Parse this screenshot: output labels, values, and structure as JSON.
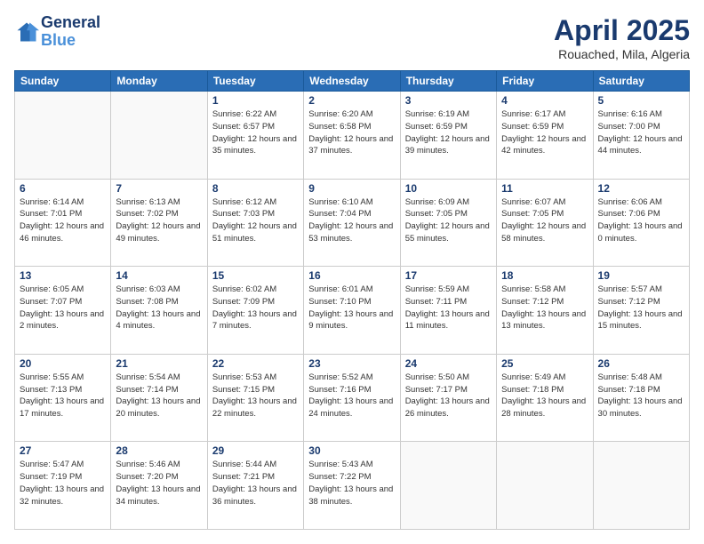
{
  "header": {
    "logo_line1": "General",
    "logo_line2": "Blue",
    "month": "April 2025",
    "location": "Rouached, Mila, Algeria"
  },
  "weekdays": [
    "Sunday",
    "Monday",
    "Tuesday",
    "Wednesday",
    "Thursday",
    "Friday",
    "Saturday"
  ],
  "weeks": [
    [
      {
        "day": "",
        "info": ""
      },
      {
        "day": "",
        "info": ""
      },
      {
        "day": "1",
        "info": "Sunrise: 6:22 AM\nSunset: 6:57 PM\nDaylight: 12 hours and 35 minutes."
      },
      {
        "day": "2",
        "info": "Sunrise: 6:20 AM\nSunset: 6:58 PM\nDaylight: 12 hours and 37 minutes."
      },
      {
        "day": "3",
        "info": "Sunrise: 6:19 AM\nSunset: 6:59 PM\nDaylight: 12 hours and 39 minutes."
      },
      {
        "day": "4",
        "info": "Sunrise: 6:17 AM\nSunset: 6:59 PM\nDaylight: 12 hours and 42 minutes."
      },
      {
        "day": "5",
        "info": "Sunrise: 6:16 AM\nSunset: 7:00 PM\nDaylight: 12 hours and 44 minutes."
      }
    ],
    [
      {
        "day": "6",
        "info": "Sunrise: 6:14 AM\nSunset: 7:01 PM\nDaylight: 12 hours and 46 minutes."
      },
      {
        "day": "7",
        "info": "Sunrise: 6:13 AM\nSunset: 7:02 PM\nDaylight: 12 hours and 49 minutes."
      },
      {
        "day": "8",
        "info": "Sunrise: 6:12 AM\nSunset: 7:03 PM\nDaylight: 12 hours and 51 minutes."
      },
      {
        "day": "9",
        "info": "Sunrise: 6:10 AM\nSunset: 7:04 PM\nDaylight: 12 hours and 53 minutes."
      },
      {
        "day": "10",
        "info": "Sunrise: 6:09 AM\nSunset: 7:05 PM\nDaylight: 12 hours and 55 minutes."
      },
      {
        "day": "11",
        "info": "Sunrise: 6:07 AM\nSunset: 7:05 PM\nDaylight: 12 hours and 58 minutes."
      },
      {
        "day": "12",
        "info": "Sunrise: 6:06 AM\nSunset: 7:06 PM\nDaylight: 13 hours and 0 minutes."
      }
    ],
    [
      {
        "day": "13",
        "info": "Sunrise: 6:05 AM\nSunset: 7:07 PM\nDaylight: 13 hours and 2 minutes."
      },
      {
        "day": "14",
        "info": "Sunrise: 6:03 AM\nSunset: 7:08 PM\nDaylight: 13 hours and 4 minutes."
      },
      {
        "day": "15",
        "info": "Sunrise: 6:02 AM\nSunset: 7:09 PM\nDaylight: 13 hours and 7 minutes."
      },
      {
        "day": "16",
        "info": "Sunrise: 6:01 AM\nSunset: 7:10 PM\nDaylight: 13 hours and 9 minutes."
      },
      {
        "day": "17",
        "info": "Sunrise: 5:59 AM\nSunset: 7:11 PM\nDaylight: 13 hours and 11 minutes."
      },
      {
        "day": "18",
        "info": "Sunrise: 5:58 AM\nSunset: 7:12 PM\nDaylight: 13 hours and 13 minutes."
      },
      {
        "day": "19",
        "info": "Sunrise: 5:57 AM\nSunset: 7:12 PM\nDaylight: 13 hours and 15 minutes."
      }
    ],
    [
      {
        "day": "20",
        "info": "Sunrise: 5:55 AM\nSunset: 7:13 PM\nDaylight: 13 hours and 17 minutes."
      },
      {
        "day": "21",
        "info": "Sunrise: 5:54 AM\nSunset: 7:14 PM\nDaylight: 13 hours and 20 minutes."
      },
      {
        "day": "22",
        "info": "Sunrise: 5:53 AM\nSunset: 7:15 PM\nDaylight: 13 hours and 22 minutes."
      },
      {
        "day": "23",
        "info": "Sunrise: 5:52 AM\nSunset: 7:16 PM\nDaylight: 13 hours and 24 minutes."
      },
      {
        "day": "24",
        "info": "Sunrise: 5:50 AM\nSunset: 7:17 PM\nDaylight: 13 hours and 26 minutes."
      },
      {
        "day": "25",
        "info": "Sunrise: 5:49 AM\nSunset: 7:18 PM\nDaylight: 13 hours and 28 minutes."
      },
      {
        "day": "26",
        "info": "Sunrise: 5:48 AM\nSunset: 7:18 PM\nDaylight: 13 hours and 30 minutes."
      }
    ],
    [
      {
        "day": "27",
        "info": "Sunrise: 5:47 AM\nSunset: 7:19 PM\nDaylight: 13 hours and 32 minutes."
      },
      {
        "day": "28",
        "info": "Sunrise: 5:46 AM\nSunset: 7:20 PM\nDaylight: 13 hours and 34 minutes."
      },
      {
        "day": "29",
        "info": "Sunrise: 5:44 AM\nSunset: 7:21 PM\nDaylight: 13 hours and 36 minutes."
      },
      {
        "day": "30",
        "info": "Sunrise: 5:43 AM\nSunset: 7:22 PM\nDaylight: 13 hours and 38 minutes."
      },
      {
        "day": "",
        "info": ""
      },
      {
        "day": "",
        "info": ""
      },
      {
        "day": "",
        "info": ""
      }
    ]
  ]
}
